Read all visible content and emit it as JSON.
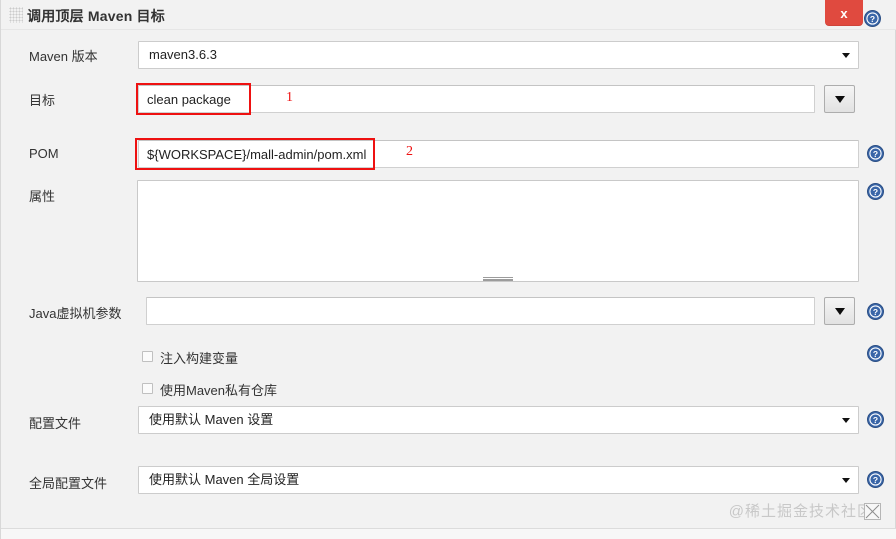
{
  "window": {
    "title": "调用顶层 Maven 目标",
    "close_label": "x",
    "grip_icon": "drag-grip-icon"
  },
  "form": {
    "maven_version": {
      "label": "Maven 版本",
      "value": "maven3.6.3"
    },
    "goals": {
      "label": "目标",
      "value": "clean package",
      "placeholder": ""
    },
    "pom": {
      "label": "POM",
      "value": "${WORKSPACE}/mall-admin/pom.xml",
      "placeholder": ""
    },
    "properties": {
      "label": "属性",
      "value": "",
      "placeholder": ""
    },
    "jvm_options": {
      "label": "Java虚拟机参数",
      "value": "",
      "placeholder": ""
    },
    "inject_build_variables": {
      "label": "注入构建变量",
      "checked": false
    },
    "use_private_maven_repo": {
      "label": "使用Maven私有仓库",
      "checked": false
    },
    "settings_file": {
      "label": "配置文件",
      "value": "使用默认 Maven 设置"
    },
    "global_settings_file": {
      "label": "全局配置文件",
      "value": "使用默认 Maven 全局设置"
    }
  },
  "annotations": [
    {
      "number": "1",
      "target": "goals-input"
    },
    {
      "number": "2",
      "target": "pom-input"
    }
  ],
  "help_icons": [
    {
      "name": "help-icon-title"
    },
    {
      "name": "help-icon-pom"
    },
    {
      "name": "help-icon-properties"
    },
    {
      "name": "help-icon-jvm"
    },
    {
      "name": "help-icon-inject-build-variables"
    },
    {
      "name": "help-icon-settings-file"
    },
    {
      "name": "help-icon-global-settings-file"
    }
  ],
  "watermark": "@稀土掘金技术社区",
  "colors": {
    "close_red": "#e04a3f",
    "annotation_red": "#ee1111",
    "help_blue": "#3a66a8",
    "panel_bg": "#f2f2f2"
  }
}
